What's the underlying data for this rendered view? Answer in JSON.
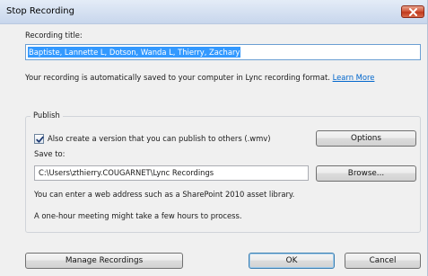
{
  "window": {
    "title": "Stop Recording",
    "close_icon": "close-icon"
  },
  "recording_title": {
    "label": "Recording title:",
    "value": "Baptiste, Lannette L, Dotson, Wanda L, Thierry, Zachary"
  },
  "info": {
    "text": "Your recording is automatically saved to your computer in Lync recording format.",
    "link": "Learn More"
  },
  "publish": {
    "group_label": "Publish",
    "checkbox_label": "Also create a version that you can publish to others (.wmv)",
    "checkbox_checked": true,
    "options_button": "Options",
    "save_to_label": "Save to:",
    "save_to_value": "C:\\Users\\zthierry.COUGARNET\\Lync Recordings",
    "browse_button": "Browse...",
    "web_address_hint": "You can enter a web address such as a SharePoint 2010 asset library.",
    "duration_hint": "A one-hour meeting might take a few hours to process."
  },
  "footer": {
    "manage_button": "Manage Recordings",
    "ok_button": "OK",
    "cancel_button": "Cancel"
  },
  "colors": {
    "link": "#0066cc",
    "selection": "#3399ff",
    "close_button": "#c0391c"
  }
}
